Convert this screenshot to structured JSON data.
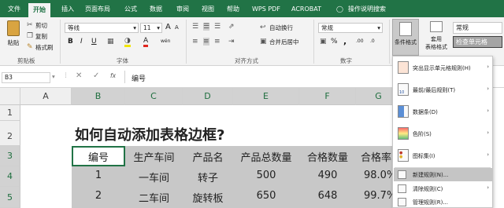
{
  "tabs": [
    {
      "label": "文件"
    },
    {
      "label": "开始"
    },
    {
      "label": "插入"
    },
    {
      "label": "页面布局"
    },
    {
      "label": "公式"
    },
    {
      "label": "数据"
    },
    {
      "label": "审阅"
    },
    {
      "label": "视图"
    },
    {
      "label": "帮助"
    },
    {
      "label": "WPS PDF"
    },
    {
      "label": "ACROBAT"
    }
  ],
  "tellme": {
    "label": "操作说明搜索"
  },
  "clipboard": {
    "paste": "粘贴",
    "cut": "剪切",
    "copy": "复制",
    "format_painter": "格式刷",
    "group": "剪贴板"
  },
  "font": {
    "name": "等线",
    "size": "11",
    "grow": "A",
    "shrink": "A",
    "wen": "wén",
    "group": "字体"
  },
  "alignment": {
    "wrap": "自动换行",
    "merge": "合并后居中",
    "group": "对齐方式"
  },
  "number": {
    "format": "常规",
    "pct": "%",
    "comma": ",",
    "group": "数字"
  },
  "styles": {
    "cond_format": "条件格式",
    "table_format_line1": "套用",
    "table_format_line2": "表格格式",
    "style_normal": "常规",
    "style_check": "检查单元格"
  },
  "formula_bar": {
    "name_box": "B3",
    "fx": "fx",
    "value": "编号"
  },
  "columns": [
    "A",
    "B",
    "C",
    "D",
    "E",
    "F",
    "G"
  ],
  "rows": [
    "1",
    "2",
    "3",
    "4",
    "5"
  ],
  "sheet": {
    "title": "如何自动添加表格边框?",
    "headers": [
      "编号",
      "生产车间",
      "产品名",
      "产品总数量",
      "合格数量",
      "合格率"
    ],
    "rows": [
      [
        "1",
        "一车间",
        "转子",
        "500",
        "490",
        "98.0%"
      ],
      [
        "2",
        "二车间",
        "旋转板",
        "650",
        "648",
        "99.7%"
      ]
    ]
  },
  "menu": {
    "items": [
      {
        "label": "突出显示单元格规则(H)",
        "arrow": "›"
      },
      {
        "label": "最前/最后规则(T)",
        "arrow": "›"
      },
      {
        "label": "数据条(D)",
        "arrow": "›"
      },
      {
        "label": "色阶(S)",
        "arrow": "›"
      },
      {
        "label": "图标集(I)",
        "arrow": "›"
      },
      {
        "label": "新建规则(N)..."
      },
      {
        "label": "清除规则(C)",
        "arrow": "›"
      },
      {
        "label": "管理规则(R)..."
      }
    ]
  },
  "colors": {
    "excel_green": "#217346",
    "selected_range": "#c8c8c8",
    "menu_highlight": "#c5c5c5"
  }
}
